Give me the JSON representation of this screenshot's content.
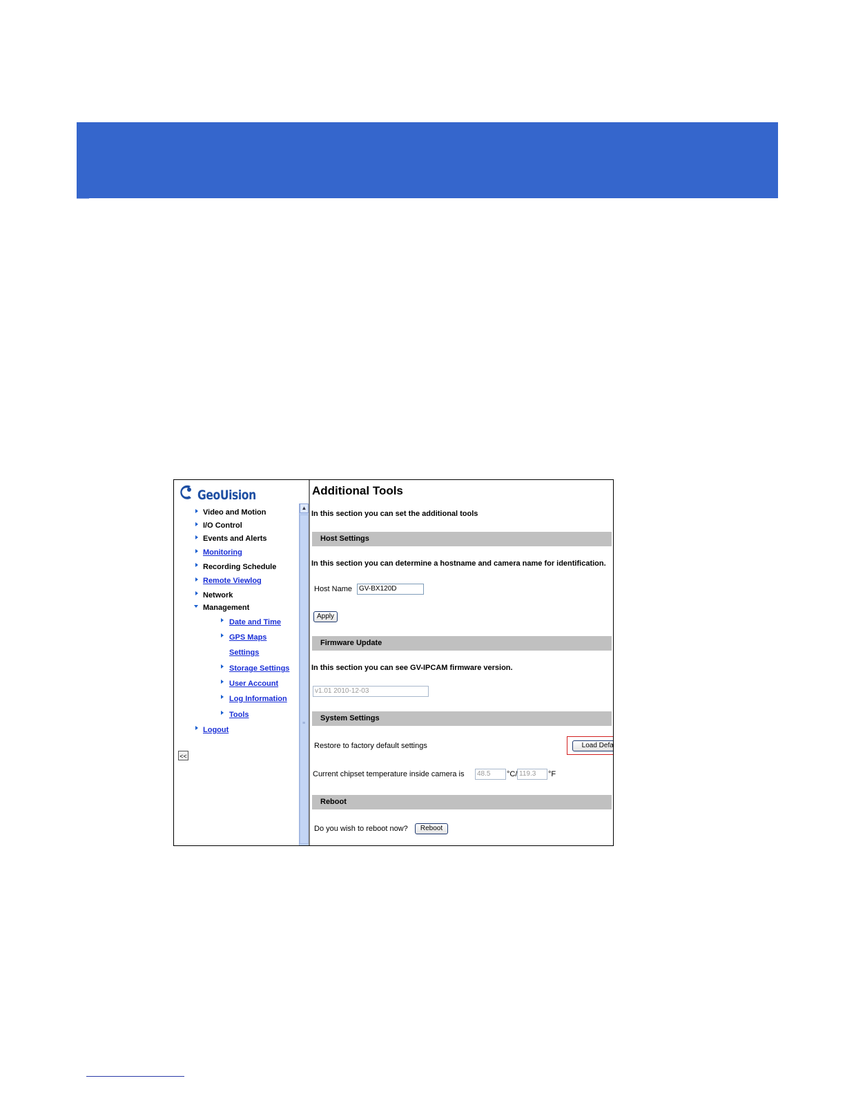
{
  "logo": {
    "text": "GeoUision"
  },
  "sidebar": {
    "items": [
      {
        "label": "Video and Motion",
        "link": false
      },
      {
        "label": "I/O Control",
        "link": false
      },
      {
        "label": "Events and Alerts",
        "link": false
      },
      {
        "label": "Monitoring",
        "link": true
      },
      {
        "label": "Recording Schedule",
        "link": false
      },
      {
        "label": "Remote Viewlog",
        "link": true
      },
      {
        "label": "Network",
        "link": false
      },
      {
        "label": "Management",
        "link": false,
        "expanded": true
      }
    ],
    "subitems": [
      {
        "label": "Date and Time"
      },
      {
        "label": "GPS Maps"
      },
      {
        "label": "Settings"
      },
      {
        "label": "Storage Settings"
      },
      {
        "label": "User Account"
      },
      {
        "label": "Log Information"
      },
      {
        "label": "Tools"
      }
    ],
    "logout": "Logout",
    "collapse_button": "<<"
  },
  "main": {
    "title": "Additional Tools",
    "intro": "In this section you can set the additional tools",
    "host": {
      "header": "Host Settings",
      "desc": "In this section you can determine a hostname and camera name for identification.",
      "hostname_label": "Host Name",
      "hostname_value": "GV-BX120D",
      "apply_button": "Apply"
    },
    "firmware": {
      "header": "Firmware Update",
      "desc": "In this section you can see GV-IPCAM firmware version.",
      "version": "v1.01 2010-12-03"
    },
    "system": {
      "header": "System Settings",
      "restore_label": "Restore to factory default settings",
      "load_default_button": "Load Default",
      "temp_label": "Current chipset temperature inside camera is",
      "temp_c": "48.5",
      "unit_c": "°C/",
      "temp_f": "119.3",
      "unit_f": "°F"
    },
    "reboot": {
      "header": "Reboot",
      "question": "Do you wish to reboot now?",
      "reboot_button": "Reboot"
    }
  },
  "colors": {
    "banner": "#3566cc",
    "highlight": "#d21f1f",
    "link": "#1a2fd6"
  }
}
